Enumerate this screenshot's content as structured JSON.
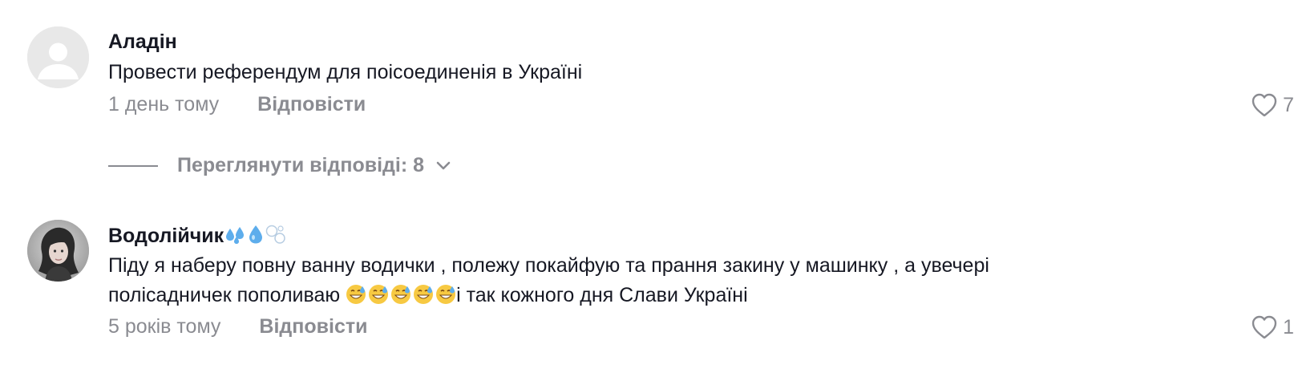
{
  "comments": [
    {
      "username": "Аладін",
      "text": "Провести референдум для поісоединенія в Україні",
      "time": "1 день тому",
      "reply_label": "Відповісти",
      "likes": "7"
    },
    {
      "username": "Водолійчик",
      "text_line1": "Піду я наберу повну ванну водички , полежу покайфую та прання закину у машинку , а увечері",
      "text_line2_before": "полісадничек пополиваю ",
      "text_line2_after": "і так кожного дня Слави Україні",
      "time": "5 років тому",
      "reply_label": "Відповісти",
      "likes": "1"
    }
  ],
  "view_replies": {
    "label": "Переглянути відповіді: 8"
  },
  "colors": {
    "text": "#161823",
    "muted": "#8a8b91",
    "avatar_default": "#e8e8e8"
  },
  "icons": {
    "like": "heart-outline-icon",
    "expand": "chevron-down-icon",
    "default_avatar": "person-silhouette-icon",
    "emoji_sweat_droplets": "💦",
    "emoji_droplet": "💧",
    "emoji_bubbles": "bubbles",
    "emoji_grin_sweat": "😅"
  }
}
